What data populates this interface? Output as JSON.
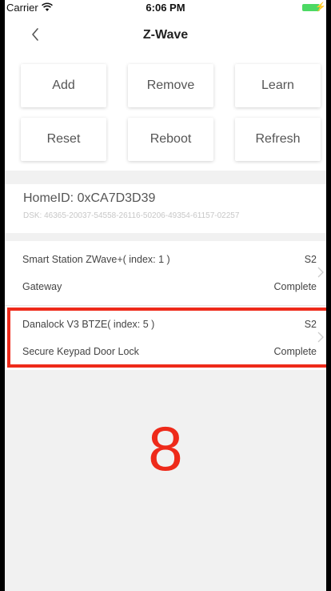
{
  "status_bar": {
    "carrier": "Carrier",
    "time": "6:06 PM"
  },
  "nav": {
    "title": "Z-Wave",
    "back_icon": "chevron-left"
  },
  "actions": {
    "add": "Add",
    "remove": "Remove",
    "learn": "Learn",
    "reset": "Reset",
    "reboot": "Reboot",
    "refresh": "Refresh"
  },
  "home": {
    "home_id": "HomeID: 0xCA7D3D39",
    "dsk": "DSK: 46365-20037-54558-26116-50206-49354-61157-02257"
  },
  "devices": [
    {
      "name": "Smart Station ZWave+( index: 1 )",
      "security": "S2",
      "type": "Gateway",
      "status": "Complete"
    },
    {
      "name": "Danalock V3 BTZE( index: 5 )",
      "security": "S2",
      "type": "Secure Keypad Door Lock",
      "status": "Complete"
    }
  ],
  "annotation": {
    "number": "8",
    "color": "#ee2a1a"
  }
}
